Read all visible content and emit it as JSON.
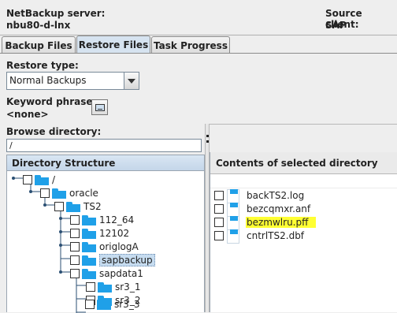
{
  "header": {
    "server_label": "NetBackup server:",
    "server_value": "nbu80-d-lnx",
    "client_label": "Source client:",
    "client_value": "SAP"
  },
  "tabs": [
    {
      "label": "Backup Files",
      "active": false
    },
    {
      "label": "Restore Files",
      "active": true
    },
    {
      "label": "Task Progress",
      "active": false
    }
  ],
  "restore": {
    "type_label": "Restore type:",
    "type_value": "Normal Backups",
    "keyword_label": "Keyword phrase:",
    "keyword_value": "<none>"
  },
  "browse": {
    "label": "Browse directory:",
    "value": "/"
  },
  "directory_structure": {
    "header": "Directory Structure",
    "nodes": [
      {
        "label": "/",
        "selected": false
      },
      {
        "label": "oracle",
        "selected": false
      },
      {
        "label": "TS2",
        "selected": false
      },
      {
        "label": "112_64",
        "selected": false
      },
      {
        "label": "12102",
        "selected": false
      },
      {
        "label": "origlogA",
        "selected": false
      },
      {
        "label": "sapbackup",
        "selected": true
      },
      {
        "label": "sapdata1",
        "selected": false
      },
      {
        "label": "sr3_1",
        "selected": false
      },
      {
        "label": "sr3_2",
        "selected": false
      },
      {
        "label": "sr3_3",
        "selected": false
      }
    ]
  },
  "contents": {
    "header": "Contents of selected directory",
    "files": [
      {
        "name": "backTS2.log",
        "highlighted": false
      },
      {
        "name": "bezcqmxr.anf",
        "highlighted": false
      },
      {
        "name": "bezmwlru.pff",
        "highlighted": true
      },
      {
        "name": "cntrlTS2.dbf",
        "highlighted": false
      }
    ]
  },
  "colors": {
    "folder": "#1fa0e8",
    "highlight": "#ffff33",
    "panel_header": "#c4d6e9",
    "selection": "#c6dcf0"
  },
  "icons": {
    "keyword": "keyword-search-icon",
    "folder": "folder-icon",
    "file": "file-icon",
    "dropdown": "chevron-down-icon"
  }
}
